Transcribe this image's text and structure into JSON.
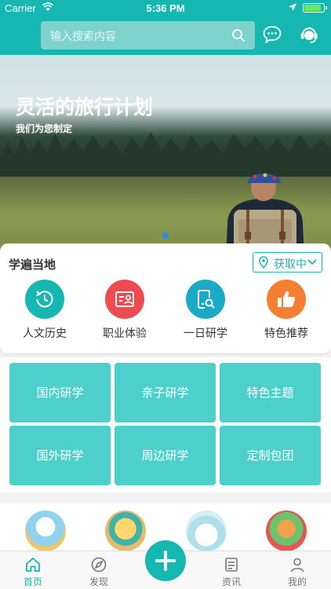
{
  "status_bar": {
    "carrier": "Carrier",
    "time": "5:36 PM"
  },
  "search": {
    "placeholder": "输入搜索内容"
  },
  "header_icons": [
    "search-icon",
    "message-icon",
    "customer-service-icon"
  ],
  "banner": {
    "title": "灵活的旅行计划",
    "subtitle": "我们为您制定",
    "page_count": 1,
    "active_page": 1
  },
  "location_card": {
    "title": "学遍当地",
    "location_button": "获取中",
    "categories": [
      {
        "label": "人文历史",
        "icon": "history-clock-icon",
        "color": "#17b7b1"
      },
      {
        "label": "职业体验",
        "icon": "id-card-icon",
        "color": "#ef4a4f"
      },
      {
        "label": "一日研学",
        "icon": "document-search-icon",
        "color": "#1aa9c6"
      },
      {
        "label": "特色推荐",
        "icon": "thumbs-up-icon",
        "color": "#f57f30"
      }
    ]
  },
  "grid": [
    {
      "label": "国内研学"
    },
    {
      "label": "亲子研学"
    },
    {
      "label": "特色主题"
    },
    {
      "label": "国外研学"
    },
    {
      "label": "周边研学"
    },
    {
      "label": "定制包团"
    }
  ],
  "tabbar": {
    "items": [
      {
        "label": "首页",
        "icon": "home-icon",
        "active": true
      },
      {
        "label": "发现",
        "icon": "discover-icon",
        "active": false
      },
      {
        "label": "资讯",
        "icon": "news-icon",
        "active": false
      },
      {
        "label": "我的",
        "icon": "profile-icon",
        "active": false
      }
    ],
    "center_icon": "plus-icon"
  },
  "colors": {
    "primary": "#17b7b1",
    "grid_button": "#4dd0cb",
    "location_active_dot": "#2a86f0"
  }
}
